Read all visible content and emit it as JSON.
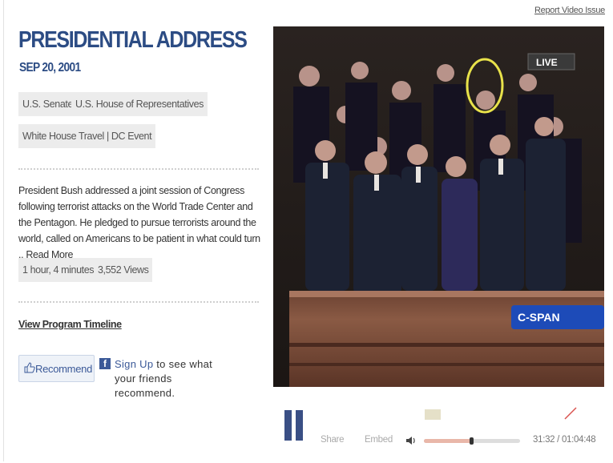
{
  "report_link": "Report Video Issue",
  "program": {
    "title": "PRESIDENTIAL ADDRESS",
    "date": "SEP 20, 2001",
    "tags": [
      "U.S. Senate",
      "U.S. House of Representatives",
      "White House Travel | DC Event"
    ],
    "description": "President Bush addressed a joint session of Congress following terrorist attacks on the World Trade Center and the Pentagon. He pledged to pursue terrorists around the world, called on Americans to be patient in what could turn ..",
    "read_more": "Read More",
    "duration": "1 hour, 4 minutes",
    "views": "3,552 Views",
    "timeline_link": "View Program Timeline"
  },
  "social": {
    "recommend_label": "Recommend",
    "signup_link": "Sign Up",
    "signup_rest": " to see what your friends recommend.",
    "fb_letter": "f"
  },
  "video": {
    "live_badge": "LIVE",
    "network_logo": "C-SPAN"
  },
  "controls": {
    "share_label": "Share",
    "embed_label": "Embed",
    "timecode": "31:32 / 01:04:48",
    "progress_fraction": 0.49,
    "volume_icon": "speaker-icon"
  },
  "colors": {
    "title": "#2c4c84",
    "pause": "#3a4f85",
    "facebook": "#3b5998"
  }
}
